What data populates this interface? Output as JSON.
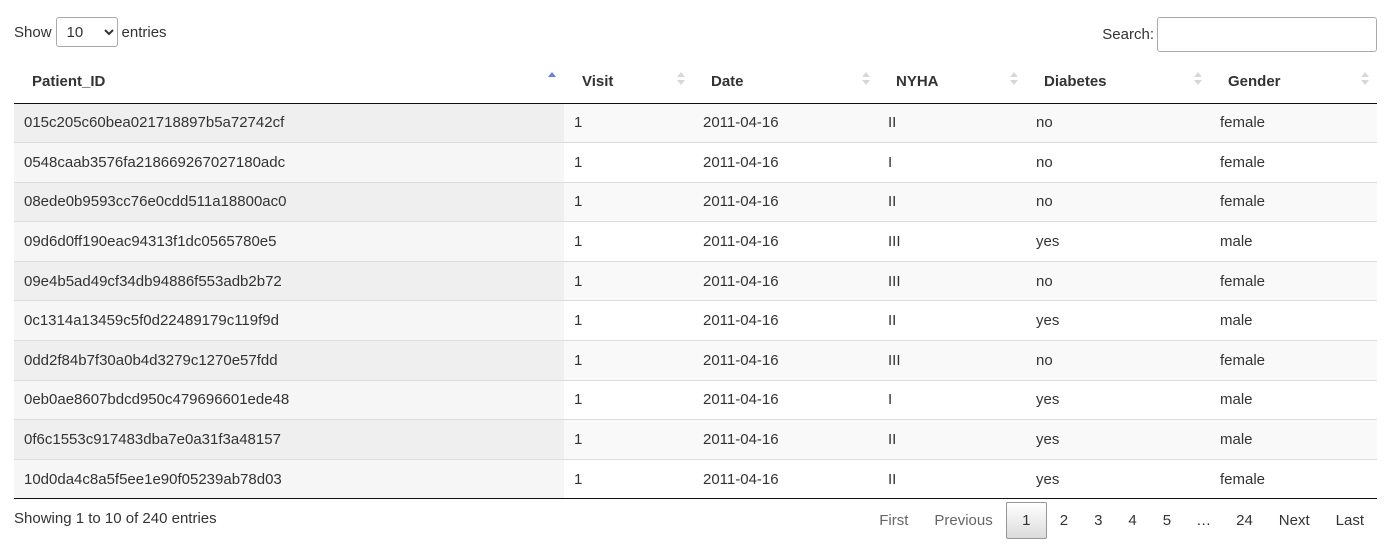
{
  "length_control": {
    "show_label": "Show",
    "selected": "10",
    "entries_label": "entries"
  },
  "search": {
    "label": "Search:",
    "value": "",
    "placeholder": ""
  },
  "table": {
    "sort_column": "Patient_ID",
    "sort_direction": "asc",
    "columns": [
      "Patient_ID",
      "Visit",
      "Date",
      "NYHA",
      "Diabetes",
      "Gender"
    ],
    "rows": [
      [
        "015c205c60bea021718897b5a72742cf",
        "1",
        "2011-04-16",
        "II",
        "no",
        "female"
      ],
      [
        "0548caab3576fa218669267027180adc",
        "1",
        "2011-04-16",
        "I",
        "no",
        "female"
      ],
      [
        "08ede0b9593cc76e0cdd511a18800ac0",
        "1",
        "2011-04-16",
        "II",
        "no",
        "female"
      ],
      [
        "09d6d0ff190eac94313f1dc0565780e5",
        "1",
        "2011-04-16",
        "III",
        "yes",
        "male"
      ],
      [
        "09e4b5ad49cf34db94886f553adb2b72",
        "1",
        "2011-04-16",
        "III",
        "no",
        "female"
      ],
      [
        "0c1314a13459c5f0d22489179c119f9d",
        "1",
        "2011-04-16",
        "II",
        "yes",
        "male"
      ],
      [
        "0dd2f84b7f30a0b4d3279c1270e57fdd",
        "1",
        "2011-04-16",
        "III",
        "no",
        "female"
      ],
      [
        "0eb0ae8607bdcd950c479696601ede48",
        "1",
        "2011-04-16",
        "I",
        "yes",
        "male"
      ],
      [
        "0f6c1553c917483dba7e0a31f3a48157",
        "1",
        "2011-04-16",
        "II",
        "yes",
        "male"
      ],
      [
        "10d0da4c8a5f5ee1e90f05239ab78d03",
        "1",
        "2011-04-16",
        "II",
        "yes",
        "female"
      ]
    ]
  },
  "info": "Showing 1 to 10 of 240 entries",
  "pagination": {
    "first": "First",
    "previous": "Previous",
    "pages": [
      "1",
      "2",
      "3",
      "4",
      "5"
    ],
    "ellipsis": "…",
    "last_page": "24",
    "next": "Next",
    "last": "Last",
    "current": "1"
  }
}
